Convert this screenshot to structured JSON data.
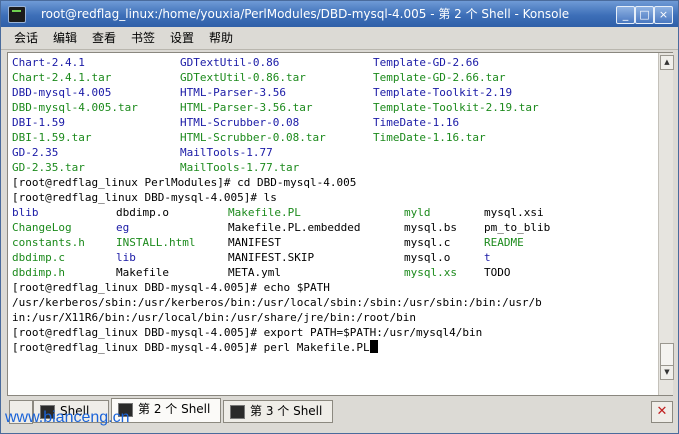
{
  "window": {
    "title": "root@redflag_linux:/home/youxia/PerlModules/DBD-mysql-4.005 - 第 2 个 Shell - Konsole",
    "buttons": {
      "minimize": "_",
      "maximize": "□",
      "close": "×"
    }
  },
  "menubar": {
    "items": [
      "会话",
      "编辑",
      "查看",
      "书签",
      "设置",
      "帮助"
    ]
  },
  "colors": {
    "dir": "#1a1aa6",
    "file": "#000000",
    "tar": "#1c8a1c",
    "titlebar": "#3d6fb8",
    "watermark": "#1a63d8"
  },
  "terminal": {
    "lines": [
      {
        "cols": [
          {
            "t": "Chart-2.4.1",
            "k": "dir"
          },
          {
            "t": "GDTextUtil-0.86",
            "k": "dir"
          },
          {
            "t": "Template-GD-2.66",
            "k": "dir"
          }
        ]
      },
      {
        "cols": [
          {
            "t": "Chart-2.4.1.tar",
            "k": "tar"
          },
          {
            "t": "GDTextUtil-0.86.tar",
            "k": "tar"
          },
          {
            "t": "Template-GD-2.66.tar",
            "k": "tar"
          }
        ]
      },
      {
        "cols": [
          {
            "t": "DBD-mysql-4.005",
            "k": "dir"
          },
          {
            "t": "HTML-Parser-3.56",
            "k": "dir"
          },
          {
            "t": "Template-Toolkit-2.19",
            "k": "dir"
          }
        ]
      },
      {
        "cols": [
          {
            "t": "DBD-mysql-4.005.tar",
            "k": "tar"
          },
          {
            "t": "HTML-Parser-3.56.tar",
            "k": "tar"
          },
          {
            "t": "Template-Toolkit-2.19.tar",
            "k": "tar"
          }
        ]
      },
      {
        "cols": [
          {
            "t": "DBI-1.59",
            "k": "dir"
          },
          {
            "t": "HTML-Scrubber-0.08",
            "k": "dir"
          },
          {
            "t": "TimeDate-1.16",
            "k": "dir"
          }
        ]
      },
      {
        "cols": [
          {
            "t": "DBI-1.59.tar",
            "k": "tar"
          },
          {
            "t": "HTML-Scrubber-0.08.tar",
            "k": "tar"
          },
          {
            "t": "TimeDate-1.16.tar",
            "k": "tar"
          }
        ]
      },
      {
        "cols": [
          {
            "t": "GD-2.35",
            "k": "dir"
          },
          {
            "t": "MailTools-1.77",
            "k": "dir"
          }
        ]
      },
      {
        "cols": [
          {
            "t": "GD-2.35.tar",
            "k": "tar"
          },
          {
            "t": "MailTools-1.77.tar",
            "k": "tar"
          }
        ]
      },
      {
        "cols": [
          {
            "t": "[root@redflag_linux PerlModules]# cd DBD-mysql-4.005",
            "k": "file"
          }
        ]
      },
      {
        "cols": [
          {
            "t": "[root@redflag_linux DBD-mysql-4.005]# ls",
            "k": "file"
          }
        ]
      },
      {
        "cols": [
          {
            "t": "blib",
            "k": "dir"
          },
          {
            "t": "dbdimp.o",
            "k": "file"
          },
          {
            "t": "Makefile.PL",
            "k": "tar"
          },
          {
            "t": "myld",
            "k": "tar"
          },
          {
            "t": "mysql.xsi",
            "k": "file"
          }
        ]
      },
      {
        "cols": [
          {
            "t": "ChangeLog",
            "k": "tar"
          },
          {
            "t": "eg",
            "k": "dir"
          },
          {
            "t": "Makefile.PL.embedded",
            "k": "file"
          },
          {
            "t": "mysql.bs",
            "k": "file"
          },
          {
            "t": "pm_to_blib",
            "k": "file"
          }
        ]
      },
      {
        "cols": [
          {
            "t": "constants.h",
            "k": "tar"
          },
          {
            "t": "INSTALL.html",
            "k": "tar"
          },
          {
            "t": "MANIFEST",
            "k": "file"
          },
          {
            "t": "mysql.c",
            "k": "file"
          },
          {
            "t": "README",
            "k": "tar"
          }
        ]
      },
      {
        "cols": [
          {
            "t": "dbdimp.c",
            "k": "tar"
          },
          {
            "t": "lib",
            "k": "dir"
          },
          {
            "t": "MANIFEST.SKIP",
            "k": "file"
          },
          {
            "t": "mysql.o",
            "k": "file"
          },
          {
            "t": "t",
            "k": "dir"
          }
        ]
      },
      {
        "cols": [
          {
            "t": "dbdimp.h",
            "k": "tar"
          },
          {
            "t": "Makefile",
            "k": "file"
          },
          {
            "t": "META.yml",
            "k": "file"
          },
          {
            "t": "mysql.xs",
            "k": "tar"
          },
          {
            "t": "TODO",
            "k": "file"
          }
        ]
      },
      {
        "cols": [
          {
            "t": "[root@redflag_linux DBD-mysql-4.005]# echo $PATH",
            "k": "file"
          }
        ]
      },
      {
        "cols": [
          {
            "t": "/usr/kerberos/sbin:/usr/kerberos/bin:/usr/local/sbin:/sbin:/usr/sbin:/bin:/usr/b",
            "k": "file"
          }
        ]
      },
      {
        "cols": [
          {
            "t": "in:/usr/X11R6/bin:/usr/local/bin:/usr/share/jre/bin:/root/bin",
            "k": "file"
          }
        ]
      },
      {
        "cols": [
          {
            "t": "[root@redflag_linux DBD-mysql-4.005]# export PATH=$PATH:/usr/mysql4/bin",
            "k": "file"
          }
        ]
      },
      {
        "cols": [
          {
            "t": "[root@redflag_linux DBD-mysql-4.005]# perl Makefile.PL",
            "k": "file"
          }
        ]
      }
    ]
  },
  "tabs": [
    {
      "label": "Shell",
      "active": false
    },
    {
      "label": "第 2 个 Shell",
      "active": true
    },
    {
      "label": "第 3 个 Shell",
      "active": false
    }
  ],
  "watermark": "www.bianceng.cn"
}
